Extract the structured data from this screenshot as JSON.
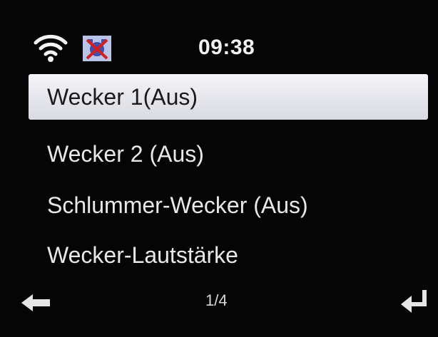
{
  "status": {
    "clock": "09:38",
    "icons": [
      "wifi-icon",
      "alarm-off-icon"
    ]
  },
  "menu": {
    "items": [
      {
        "label": "Wecker 1(Aus)",
        "selected": true
      },
      {
        "label": "Wecker 2 (Aus)",
        "selected": false
      },
      {
        "label": "Schlummer-Wecker (Aus)",
        "selected": false
      },
      {
        "label": "Wecker-Lautstärke",
        "selected": false
      }
    ]
  },
  "footer": {
    "page": "1/4",
    "left_icon": "back-arrow-icon",
    "right_icon": "enter-icon"
  },
  "colors": {
    "background": "#050505",
    "selection": "#e4e5ea",
    "text": "#e8e8e8",
    "alarm_cross": "#d42020"
  }
}
